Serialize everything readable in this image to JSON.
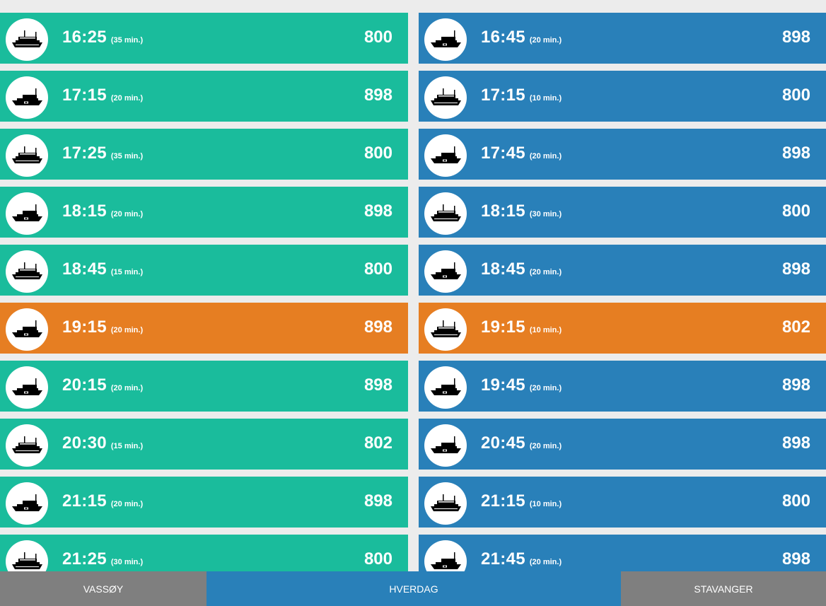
{
  "left_column": {
    "color": "#1abc9c",
    "rows": [
      {
        "time": "",
        "duration": "",
        "route": "",
        "highlight": false
      },
      {
        "time": "16:25",
        "duration": "(35 min.)",
        "route": "800",
        "highlight": false,
        "icon": "ferry-icon"
      },
      {
        "time": "17:15",
        "duration": "(20 min.)",
        "route": "898",
        "highlight": false,
        "icon": "fast-boat-icon"
      },
      {
        "time": "17:25",
        "duration": "(35 min.)",
        "route": "800",
        "highlight": false,
        "icon": "ferry-icon"
      },
      {
        "time": "18:15",
        "duration": "(20 min.)",
        "route": "898",
        "highlight": false,
        "icon": "fast-boat-icon"
      },
      {
        "time": "18:45",
        "duration": "(15 min.)",
        "route": "800",
        "highlight": false,
        "icon": "ferry-icon"
      },
      {
        "time": "19:15",
        "duration": "(20 min.)",
        "route": "898",
        "highlight": true,
        "icon": "fast-boat-icon"
      },
      {
        "time": "20:15",
        "duration": "(20 min.)",
        "route": "898",
        "highlight": false,
        "icon": "fast-boat-icon"
      },
      {
        "time": "20:30",
        "duration": "(15 min.)",
        "route": "802",
        "highlight": false,
        "icon": "ferry-icon"
      },
      {
        "time": "21:15",
        "duration": "(20 min.)",
        "route": "898",
        "highlight": false,
        "icon": "fast-boat-icon"
      },
      {
        "time": "21:25",
        "duration": "(30 min.)",
        "route": "800",
        "highlight": false,
        "icon": "ferry-icon"
      }
    ]
  },
  "right_column": {
    "color": "#2980b9",
    "rows": [
      {
        "time": "",
        "duration": "",
        "route": "",
        "highlight": false
      },
      {
        "time": "16:45",
        "duration": "(20 min.)",
        "route": "898",
        "highlight": false,
        "icon": "fast-boat-icon"
      },
      {
        "time": "17:15",
        "duration": "(10 min.)",
        "route": "800",
        "highlight": false,
        "icon": "ferry-icon"
      },
      {
        "time": "17:45",
        "duration": "(20 min.)",
        "route": "898",
        "highlight": false,
        "icon": "fast-boat-icon"
      },
      {
        "time": "18:15",
        "duration": "(30 min.)",
        "route": "800",
        "highlight": false,
        "icon": "ferry-icon"
      },
      {
        "time": "18:45",
        "duration": "(20 min.)",
        "route": "898",
        "highlight": false,
        "icon": "fast-boat-icon"
      },
      {
        "time": "19:15",
        "duration": "(10 min.)",
        "route": "802",
        "highlight": true,
        "icon": "ferry-icon"
      },
      {
        "time": "19:45",
        "duration": "(20 min.)",
        "route": "898",
        "highlight": false,
        "icon": "fast-boat-icon"
      },
      {
        "time": "20:45",
        "duration": "(20 min.)",
        "route": "898",
        "highlight": false,
        "icon": "fast-boat-icon"
      },
      {
        "time": "21:15",
        "duration": "(10 min.)",
        "route": "800",
        "highlight": false,
        "icon": "ferry-icon"
      },
      {
        "time": "21:45",
        "duration": "(20 min.)",
        "route": "898",
        "highlight": false,
        "icon": "fast-boat-icon"
      }
    ]
  },
  "highlight_color": "#e67e22",
  "footer": {
    "left_label": "VASSØY",
    "middle_label": "HVERDAG",
    "right_label": "STAVANGER"
  }
}
